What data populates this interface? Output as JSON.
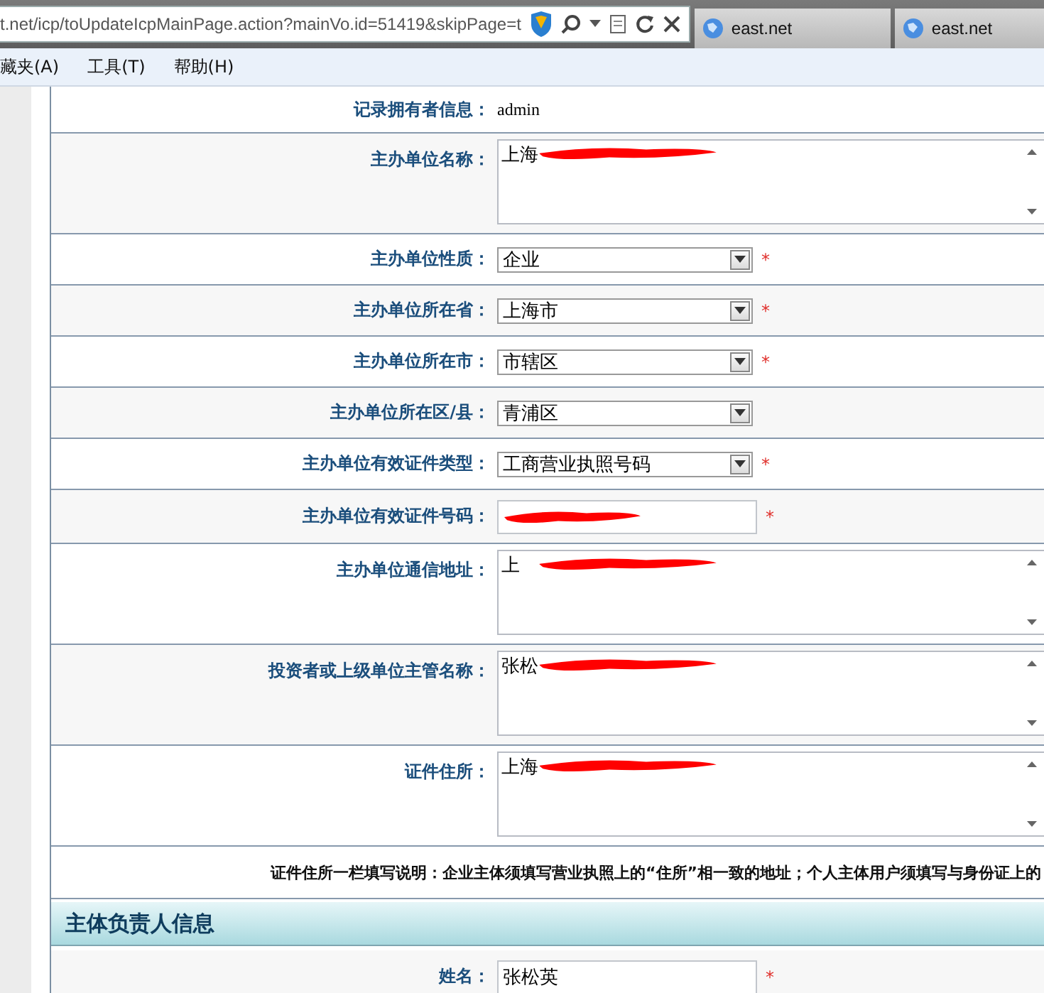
{
  "browser": {
    "address": "t.net/icp/toUpdateIcpMainPage.action?mainVo.id=51419&skipPage=t",
    "tabs": [
      {
        "title": "east.net",
        "selected": false
      },
      {
        "title": "east.net",
        "selected": false
      }
    ]
  },
  "menu": [
    "藏夹(A)",
    "工具(T)",
    "帮助(H)"
  ],
  "form_rows": [
    {
      "kind": "text",
      "label": "记录拥有者信息：",
      "value": "admin"
    },
    {
      "kind": "textarea",
      "label": "主办单位名称：",
      "value": "上海",
      "redacted": true
    },
    {
      "kind": "select",
      "label": "主办单位性质：",
      "value": "企业",
      "mark": "*"
    },
    {
      "kind": "select",
      "label": "主办单位所在省：",
      "value": "上海市",
      "mark": "*"
    },
    {
      "kind": "select",
      "label": "主办单位所在市：",
      "value": "市辖区",
      "mark": "*"
    },
    {
      "kind": "select",
      "label": "主办单位所在区/县：",
      "value": "青浦区"
    },
    {
      "kind": "select",
      "label": "主办单位有效证件类型：",
      "value": "工商营业执照号码",
      "mark": "*"
    },
    {
      "kind": "input",
      "label": "主办单位有效证件号码：",
      "redacted": true,
      "mark": "*"
    },
    {
      "kind": "textarea",
      "label": "主办单位通信地址：",
      "value": "上",
      "redacted": true
    },
    {
      "kind": "textarea",
      "label": "投资者或上级单位主管名称：",
      "value": "张松",
      "redacted": true
    },
    {
      "kind": "textarea",
      "label": "证件住所：",
      "value": "上海",
      "redacted": true
    },
    {
      "kind": "note",
      "value": "证件住所一栏填写说明：企业主体须填写营业执照上的“住所”相一致的地址；个人主体用户须填写与身份证上的"
    },
    {
      "kind": "section",
      "value": "主体负责人信息"
    },
    {
      "kind": "input",
      "label": "姓名：",
      "value": "张松英",
      "mark": "*"
    }
  ]
}
